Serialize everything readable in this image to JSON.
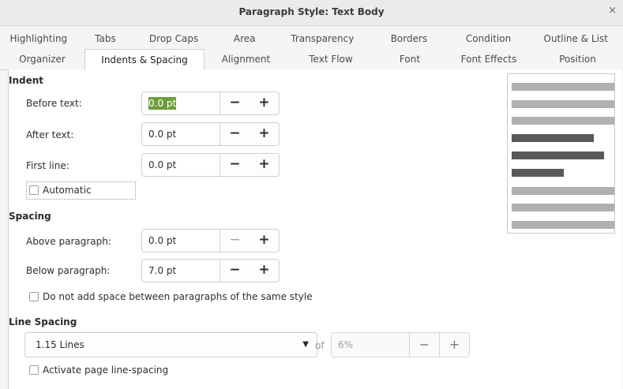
{
  "window": {
    "title": "Paragraph Style: Text Body",
    "close_symbol": "×"
  },
  "tabs_row1": [
    "Highlighting",
    "Tabs",
    "Drop Caps",
    "Area",
    "Transparency",
    "Borders",
    "Condition",
    "Outline & List"
  ],
  "tabs_row2": [
    "Organizer",
    "Indents & Spacing",
    "Alignment",
    "Text Flow",
    "Font",
    "Font Effects",
    "Position"
  ],
  "active_tab": "Indents & Spacing",
  "indent": {
    "heading": "Indent",
    "before_text": {
      "label": "Before text:",
      "value": "0.0 pt"
    },
    "after_text": {
      "label": "After text:",
      "value": "0.0 pt"
    },
    "first_line": {
      "label": "First line:",
      "value": "0.0 pt"
    },
    "automatic": {
      "label": "Automatic",
      "checked": false
    }
  },
  "spacing": {
    "heading": "Spacing",
    "above": {
      "label": "Above paragraph:",
      "value": "0.0 pt"
    },
    "below": {
      "label": "Below paragraph:",
      "value": "7.0 pt"
    },
    "no_space_same_style": {
      "label": "Do not add space between paragraphs of the same style",
      "checked": false
    }
  },
  "line_spacing": {
    "heading": "Line Spacing",
    "selected": "1.15 Lines",
    "of_label": "of",
    "of_value": "6%",
    "activate_page": {
      "label": "Activate page line-spacing",
      "checked": false
    }
  },
  "spin": {
    "minus": "−",
    "plus": "+"
  },
  "icons": {
    "dropdown": "dropdown-arrow-icon",
    "close": "close-icon"
  },
  "colors": {
    "selection_highlight": "#6e9e3a",
    "preview_light": "#b0b0b0",
    "preview_dark": "#595959"
  }
}
